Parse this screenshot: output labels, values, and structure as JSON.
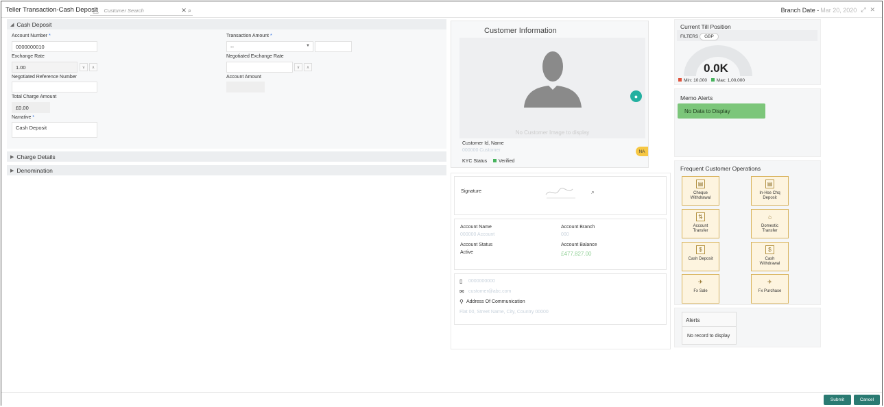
{
  "header": {
    "title": "Teller Transaction-Cash Deposit",
    "customer_search_placeholder": "Customer Search",
    "branch_date_label": "Branch Date -",
    "branch_date_value": "Mar 20, 2020"
  },
  "cash_deposit": {
    "section_title": "Cash Deposit",
    "account_number_label": "Account Number",
    "account_number_value": "0000000010",
    "transaction_amount_label": "Transaction Amount",
    "transaction_currency": "--",
    "exchange_rate_label": "Exchange Rate",
    "exchange_rate_value": "1.00",
    "negotiated_exchange_rate_label": "Negotiated Exchange Rate",
    "negotiated_reference_label": "Negotiated Reference Number",
    "account_amount_label": "Account Amount",
    "total_charge_label": "Total Charge Amount",
    "total_charge_value": "£0.00",
    "narrative_label": "Narrative",
    "narrative_value": "Cash Deposit"
  },
  "sections": {
    "charge_details": "Charge Details",
    "denomination": "Denomination"
  },
  "customer_info": {
    "title": "Customer Information",
    "no_image": "No Customer Image to display",
    "id_name_label": "Customer Id, Name",
    "id_name_value": "000000 Customer",
    "kyc_label": "KYC Status",
    "kyc_value": "Verified",
    "na_badge": "NA",
    "signature_label": "Signature",
    "account_name_label": "Account Name",
    "account_name_value": "000000 Account",
    "account_branch_label": "Account Branch",
    "account_branch_value": "000",
    "account_status_label": "Account Status",
    "account_status_value": "Active",
    "account_balance_label": "Account Balance",
    "account_balance_value": "£477,827.00",
    "phone_value": "0000000000",
    "email_value": "customer@abc.com",
    "address_label": "Address Of Communication",
    "address_value": "Flat 00, Street Name, City, Country 00000"
  },
  "till": {
    "title": "Current Till Position",
    "filters_label": "FILTERS",
    "currency_chip": "GBP",
    "value": "0.0K",
    "min_label": "Min: 10,000",
    "max_label": "Max: 1,00,000",
    "min_color": "#e0533c",
    "max_color": "#47b35d"
  },
  "memo": {
    "title": "Memo Alerts",
    "no_data": "No Data to Display"
  },
  "operations": {
    "title": "Frequent Customer Operations",
    "items": [
      {
        "label_l1": "Cheque",
        "label_l2": "Withdrawal",
        "icon": "cheque-icon"
      },
      {
        "label_l1": "In-Hse Chq",
        "label_l2": "Deposit",
        "icon": "inhouse-cheque-icon"
      },
      {
        "label_l1": "Account",
        "label_l2": "Transfer",
        "icon": "account-transfer-icon"
      },
      {
        "label_l1": "Domestic",
        "label_l2": "Transfer",
        "icon": "bank-icon"
      },
      {
        "label_l1": "Cash Deposit",
        "label_l2": "",
        "icon": "cash-deposit-icon"
      },
      {
        "label_l1": "Cash",
        "label_l2": "Withdrawal",
        "icon": "cash-withdrawal-icon"
      },
      {
        "label_l1": "Fx Sale",
        "label_l2": "",
        "icon": "fx-sale-icon"
      },
      {
        "label_l1": "Fx Purchase",
        "label_l2": "",
        "icon": "fx-purchase-icon"
      }
    ]
  },
  "alerts": {
    "title": "Alerts",
    "no_record": "No record to display"
  },
  "footer": {
    "submit": "Submit",
    "cancel": "Cancel",
    "button_color": "#2a7a72"
  }
}
